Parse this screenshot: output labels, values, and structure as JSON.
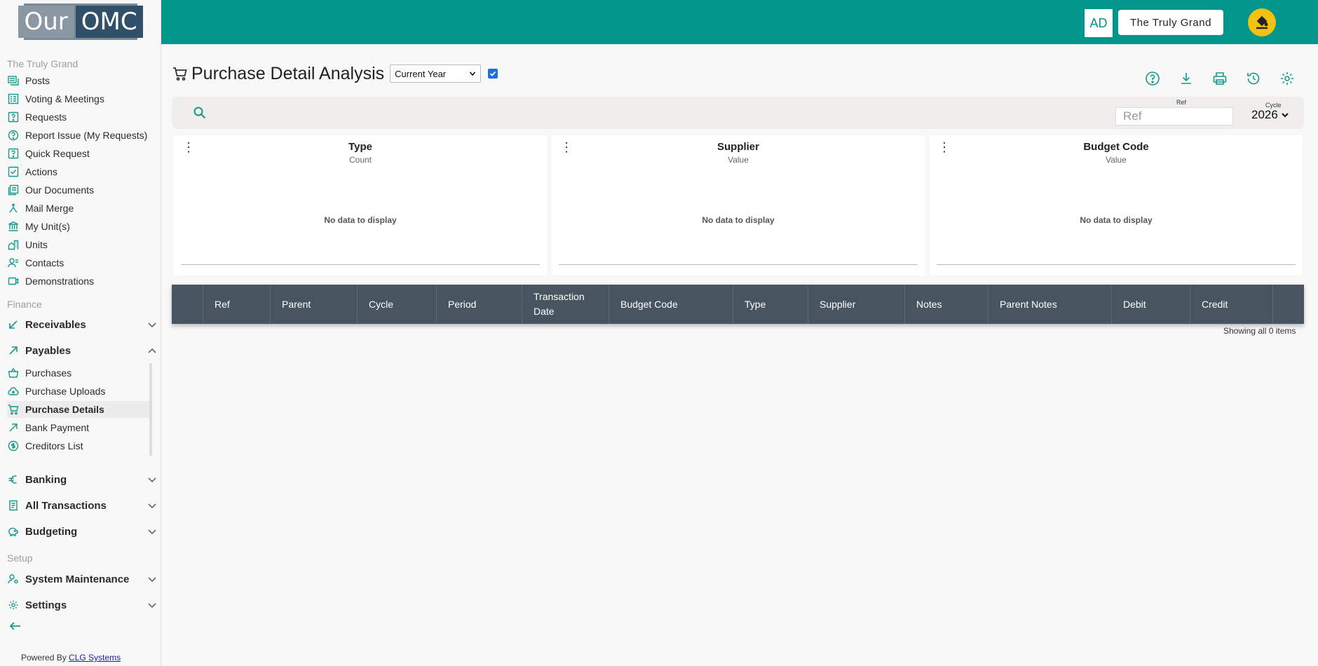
{
  "logo": {
    "part1": "Our",
    "part2": "OMC"
  },
  "sidebar": {
    "section1": "The Truly Grand",
    "items1": [
      {
        "label": "Posts",
        "icon": "posts-icon"
      },
      {
        "label": "Voting & Meetings",
        "icon": "ballot-icon"
      },
      {
        "label": "Requests",
        "icon": "help-box-icon"
      },
      {
        "label": "Report Issue (My Requests)",
        "icon": "help-circle-icon"
      },
      {
        "label": "Quick Request",
        "icon": "help-box-icon"
      },
      {
        "label": "Actions",
        "icon": "checkbox-icon"
      },
      {
        "label": "Our Documents",
        "icon": "documents-icon"
      },
      {
        "label": "Mail Merge",
        "icon": "merge-icon"
      },
      {
        "label": "My Unit(s)",
        "icon": "bank-icon"
      },
      {
        "label": "Units",
        "icon": "building-icon"
      },
      {
        "label": "Contacts",
        "icon": "contacts-icon"
      },
      {
        "label": "Demonstrations",
        "icon": "video-icon"
      }
    ],
    "section2": "Finance",
    "receivables": "Receivables",
    "payables": "Payables",
    "payables_items": [
      {
        "label": "Purchases",
        "icon": "basket-icon"
      },
      {
        "label": "Purchase Uploads",
        "icon": "cloud-upload-icon"
      },
      {
        "label": "Purchase Details",
        "icon": "cart-icon"
      },
      {
        "label": "Bank Payment",
        "icon": "arrow-up-right-icon"
      },
      {
        "label": "Creditors List",
        "icon": "dollar-circle-icon"
      }
    ],
    "banking": "Banking",
    "all_transactions": "All Transactions",
    "budgeting": "Budgeting",
    "section3": "Setup",
    "system_maintenance": "System Maintenance",
    "settings": "Settings",
    "powered_by": "Powered By",
    "powered_link": "CLG Systems"
  },
  "header": {
    "avatar": "AD",
    "tenant": "The Truly Grand"
  },
  "page": {
    "title": "Purchase Detail Analysis",
    "period": "Current Year",
    "checkbox_checked": true
  },
  "filter": {
    "ref_label": "Ref",
    "ref_placeholder": "Ref",
    "cycle_label": "Cycle",
    "cycle_value": "2026"
  },
  "cards": [
    {
      "title": "Type",
      "subtitle": "Count",
      "empty": "No data to display"
    },
    {
      "title": "Supplier",
      "subtitle": "Value",
      "empty": "No data to display"
    },
    {
      "title": "Budget Code",
      "subtitle": "Value",
      "empty": "No data to display"
    }
  ],
  "table": {
    "columns": [
      "Ref",
      "Parent",
      "Cycle",
      "Period",
      "Transaction Date",
      "Budget Code",
      "Type",
      "Supplier",
      "Notes",
      "Parent Notes",
      "Debit",
      "Credit"
    ],
    "rows": [],
    "footer": "Showing all 0 items"
  }
}
